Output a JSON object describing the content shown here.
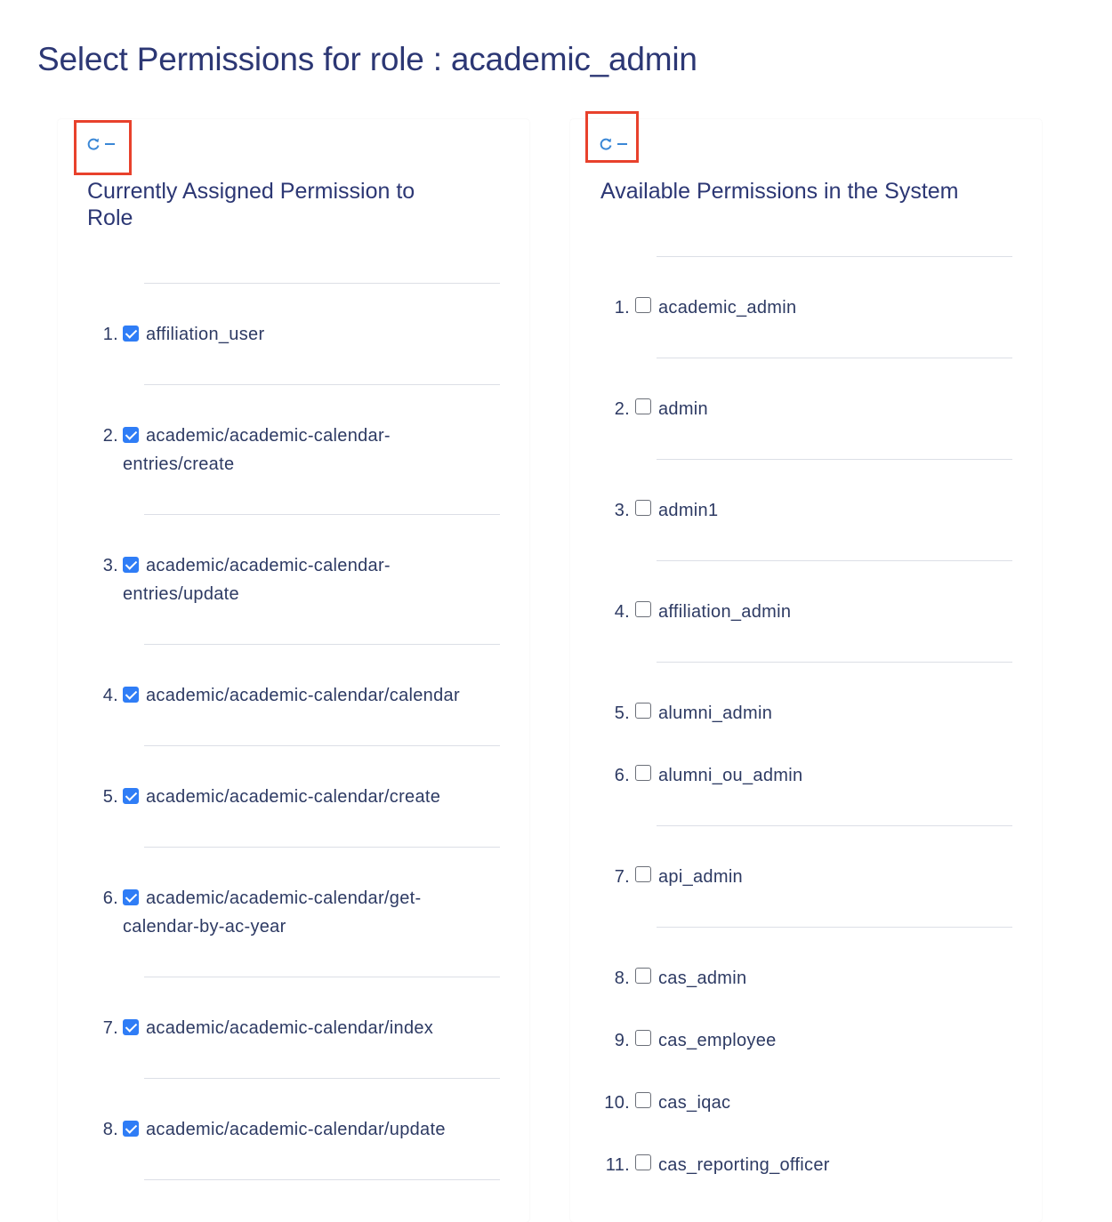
{
  "page": {
    "title": "Select Permissions for role : academic_admin"
  },
  "assigned_panel": {
    "title": "Currently Assigned Permission to Role",
    "title_lines": [
      "Currently Assigned Permission to",
      "Role"
    ],
    "tool_icons": [
      "refresh-icon",
      "minimize-icon"
    ],
    "items": [
      {
        "num": "1.",
        "lines": [
          "affiliation_user"
        ],
        "checked": true
      },
      {
        "num": "2.",
        "lines": [
          "academic/academic-calendar-",
          "entries/create"
        ],
        "checked": true
      },
      {
        "num": "3.",
        "lines": [
          "academic/academic-calendar-",
          "entries/update"
        ],
        "checked": true
      },
      {
        "num": "4.",
        "lines": [
          "academic/academic-calendar/calendar"
        ],
        "checked": true
      },
      {
        "num": "5.",
        "lines": [
          "academic/academic-calendar/create"
        ],
        "checked": true
      },
      {
        "num": "6.",
        "lines": [
          "academic/academic-calendar/get-",
          "calendar-by-ac-year"
        ],
        "checked": true
      },
      {
        "num": "7.",
        "lines": [
          "academic/academic-calendar/index"
        ],
        "checked": true
      },
      {
        "num": "8.",
        "lines": [
          "academic/academic-calendar/update"
        ],
        "checked": true
      }
    ]
  },
  "available_panel": {
    "title": "Available Permissions in the System",
    "tool_icons": [
      "refresh-icon",
      "minimize-icon"
    ],
    "items": [
      {
        "num": "1.",
        "label": "academic_admin",
        "checked": false
      },
      {
        "num": "2.",
        "label": "admin",
        "checked": false
      },
      {
        "num": "3.",
        "label": "admin1",
        "checked": false
      },
      {
        "num": "4.",
        "label": "affiliation_admin",
        "checked": false
      },
      {
        "num": "5.",
        "label": "alumni_admin",
        "checked": false
      },
      {
        "num": "6.",
        "label": "alumni_ou_admin",
        "checked": false
      },
      {
        "num": "7.",
        "label": "api_admin",
        "checked": false
      },
      {
        "num": "8.",
        "label": "cas_admin",
        "checked": false
      },
      {
        "num": "9.",
        "label": "cas_employee",
        "checked": false
      },
      {
        "num": "10.",
        "label": "cas_iqac",
        "checked": false
      },
      {
        "num": "11.",
        "label": "cas_reporting_officer",
        "checked": false
      }
    ]
  },
  "colors": {
    "title": "#2c3774",
    "text": "#2d3a63",
    "tool_icon": "#3a87d6",
    "checkbox_checked": "#2f7df6",
    "highlight_box": "#e8412c",
    "divider": "#dcdfe6"
  }
}
